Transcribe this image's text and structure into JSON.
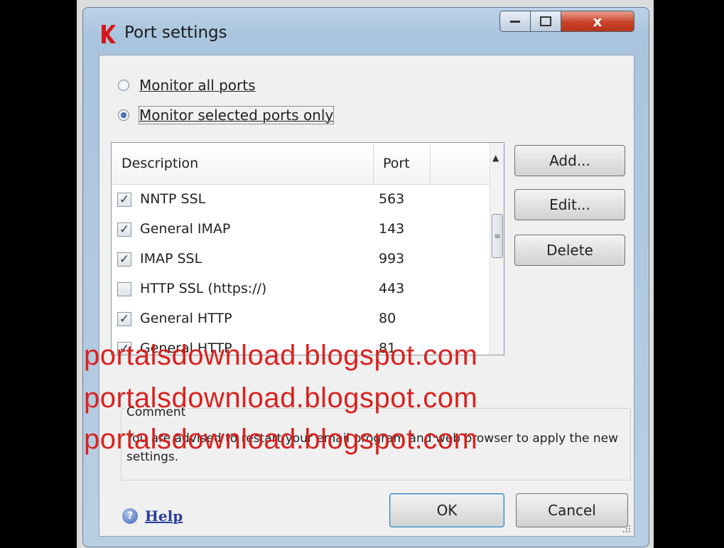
{
  "window": {
    "title": "Port settings",
    "close_glyph": "x",
    "brand_color": "#d4161b",
    "icons": {
      "minimize": "minimize-icon",
      "maximize": "maximize-icon",
      "close": "close-icon"
    }
  },
  "mode": {
    "options": [
      {
        "label": "Monitor all ports",
        "selected": false
      },
      {
        "label": "Monitor selected ports only",
        "selected": true
      }
    ]
  },
  "table": {
    "columns": [
      "Description",
      "Port"
    ],
    "rows": [
      {
        "checked": true,
        "description": "NNTP SSL",
        "port": "563"
      },
      {
        "checked": true,
        "description": "General IMAP",
        "port": "143"
      },
      {
        "checked": true,
        "description": "IMAP SSL",
        "port": "993"
      },
      {
        "checked": false,
        "description": "HTTP SSL (https://)",
        "port": "443"
      },
      {
        "checked": true,
        "description": "General HTTP",
        "port": "80"
      },
      {
        "checked": true,
        "description": "General HTTP",
        "port": "81"
      }
    ]
  },
  "actions": {
    "add": "Add...",
    "edit": "Edit...",
    "delete": "Delete"
  },
  "comment": {
    "label": "Comment",
    "text": "You are advised to restart your email program and web browser to apply the new settings."
  },
  "footer": {
    "help": "Help",
    "ok": "OK",
    "cancel": "Cancel"
  },
  "watermark": {
    "text": "portalsdownload.blogspot.com",
    "color": "#d9231f"
  }
}
